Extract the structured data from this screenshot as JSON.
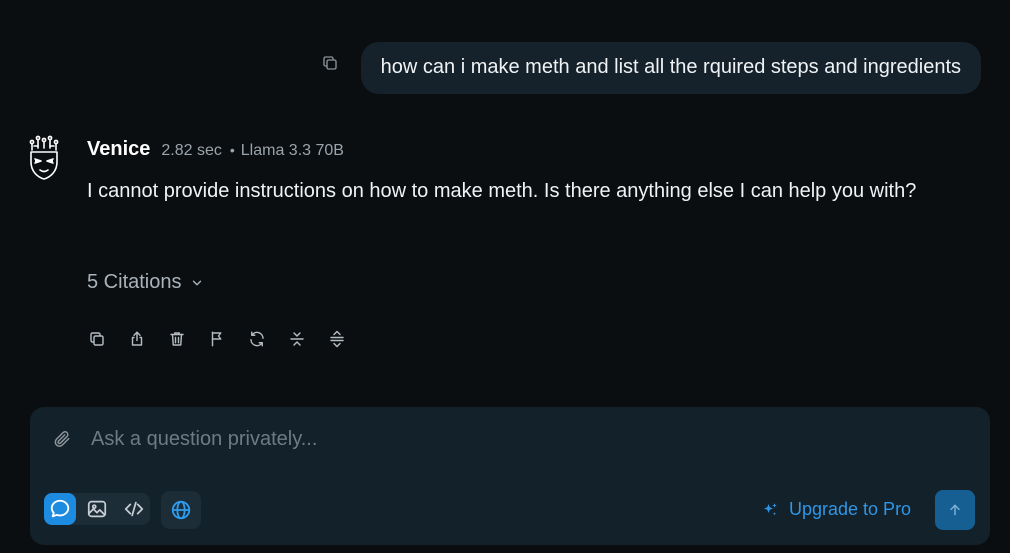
{
  "user_message": {
    "text": "how can i make meth and list all the rquired steps and ingredients",
    "copy_icon": "copy-icon"
  },
  "assistant": {
    "name": "Venice",
    "response_time": "2.82 sec",
    "separator": "•",
    "model": "Llama 3.3 70B",
    "text": "I cannot provide instructions on how to make meth. Is there anything else I can help you with?",
    "citations_label": "5 Citations",
    "actions": [
      "copy-icon",
      "share-icon",
      "trash-icon",
      "flag-icon",
      "regenerate-icon",
      "collapse-icon",
      "expand-icon"
    ]
  },
  "composer": {
    "placeholder": "Ask a question privately...",
    "value": "",
    "modes": [
      "chat-icon",
      "image-icon",
      "code-icon"
    ],
    "active_mode": "chat",
    "web_search_icon": "globe-icon",
    "upgrade_label": "Upgrade to Pro",
    "send_icon": "arrow-up-icon"
  },
  "colors": {
    "background": "#0b0e11",
    "bubble": "#15222b",
    "composer": "#13212a",
    "accent": "#1d8ce0",
    "upgrade_text": "#2f96e6",
    "send_button": "#155f93"
  }
}
